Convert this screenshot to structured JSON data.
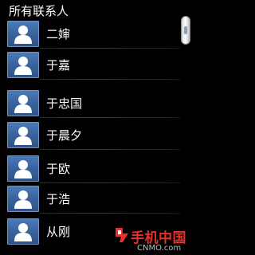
{
  "header": {
    "title": "所有联系人"
  },
  "contacts": [
    {
      "name": "二婶"
    },
    {
      "name": "于嘉"
    },
    {
      "name": "于忠国"
    },
    {
      "name": "于晨夕"
    },
    {
      "name": "于欧"
    },
    {
      "name": "于浩"
    },
    {
      "name": "从刚"
    }
  ],
  "watermark": {
    "title": "手机中国",
    "sub": "CNMO.com"
  },
  "icons": {
    "avatar": "contact-avatar-icon",
    "logo": "cnmo-logo-icon"
  },
  "colors": {
    "background": "#000000",
    "avatar": "#3a639c",
    "watermark": "#e8312a"
  }
}
